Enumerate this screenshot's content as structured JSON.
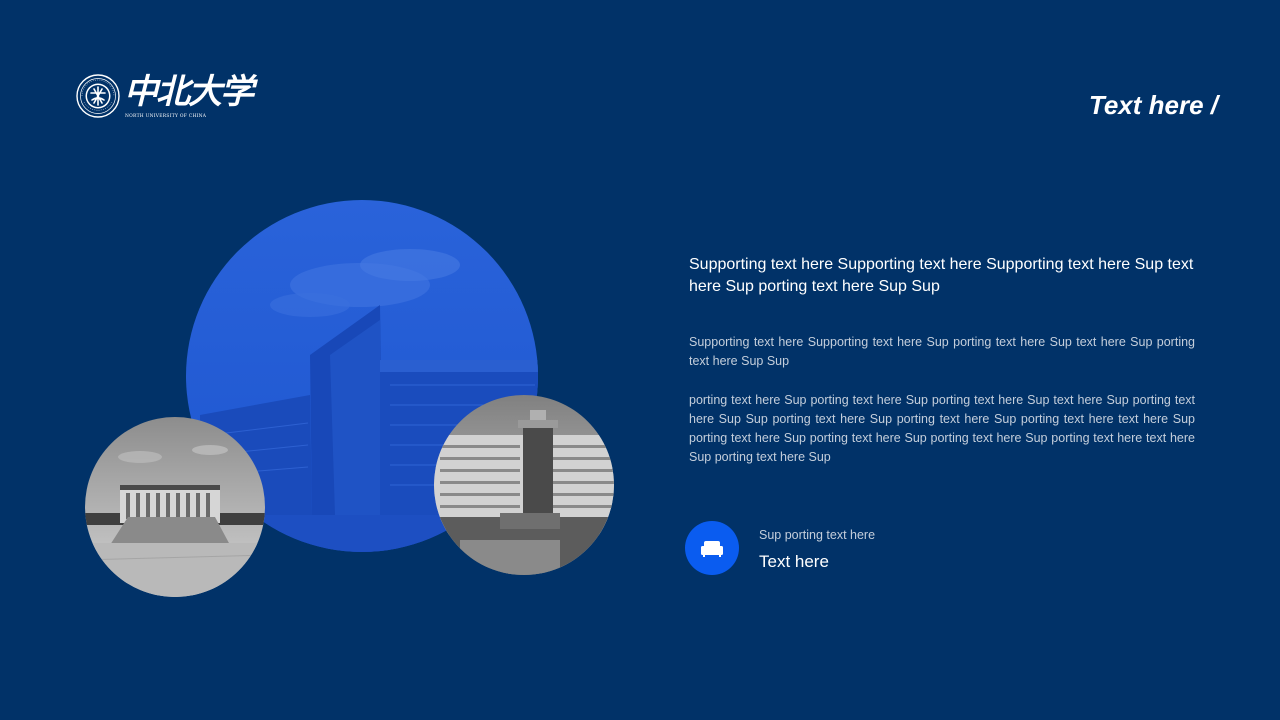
{
  "brand": {
    "name_cn": "中北大学",
    "name_en": "NORTH UNIVERSITY OF CHINA",
    "logo_icon": "university-seal"
  },
  "header": {
    "title": "Text here /"
  },
  "content": {
    "lead": "Supporting text here Supporting text here Supporting text here Sup text here Sup porting text here Sup Sup",
    "para_1": "Supporting text here Supporting text here Sup porting text here Sup text here Sup porting text here Sup Sup",
    "para_2": "porting text here Sup porting text here Sup porting text here Sup text here Sup porting text here Sup Sup porting text here Sup porting text here Sup porting text here text here Sup porting text here Sup porting text here Sup porting text here Sup porting text here text here Sup porting text here Sup"
  },
  "feature": {
    "icon": "sofa-icon",
    "caption": "Sup porting text here",
    "title": "Text here"
  },
  "photos": [
    {
      "name": "building-photo-blue",
      "tint": "#1f5ad6"
    },
    {
      "name": "auditorium-photo",
      "tint": "grayscale"
    },
    {
      "name": "campus-building-photo",
      "tint": "grayscale"
    }
  ],
  "colors": {
    "background": "#013268",
    "accent": "#0a5cf0",
    "text_primary": "#ffffff",
    "text_secondary": "#c4cedb"
  }
}
